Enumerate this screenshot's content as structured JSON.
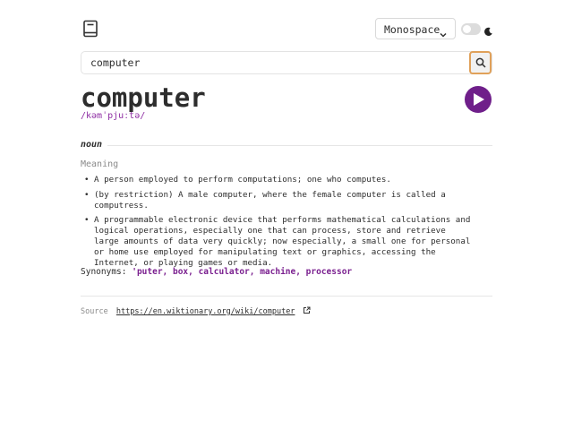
{
  "header": {
    "font_selector": {
      "selected": "Monospace"
    },
    "icons": {
      "logo": "book-icon",
      "dropdown": "chevron-down-icon",
      "theme": "moon-icon"
    },
    "theme_toggle_on": false
  },
  "search": {
    "value": "computer",
    "button_icon": "search-icon"
  },
  "entry": {
    "word": "computer",
    "phonetic": "/kəmˈpjuːtə/",
    "play_icon": "play-icon",
    "part_of_speech": "noun",
    "meaning_label": "Meaning",
    "definitions": [
      "A person employed to perform computations; one who computes.",
      "(by restriction) A male computer, where the female computer is called a computress.",
      "A programmable electronic device that performs mathematical calculations and logical operations, especially one that can process, store and retrieve large amounts of data very quickly; now especially, a small one for personal or home use employed for manipulating text or graphics, accessing the Internet, or playing games or media."
    ],
    "synonyms_label": "Synonyms:",
    "synonyms": "'puter, box, calculator, machine, processor"
  },
  "source": {
    "label": "Source",
    "url": "https://en.wiktionary.org/wiki/computer",
    "icon": "external-link-icon"
  },
  "colors": {
    "accent_purple": "#8e2da3",
    "play_button": "#6f1f8a",
    "search_button_border": "#e0a15a"
  }
}
